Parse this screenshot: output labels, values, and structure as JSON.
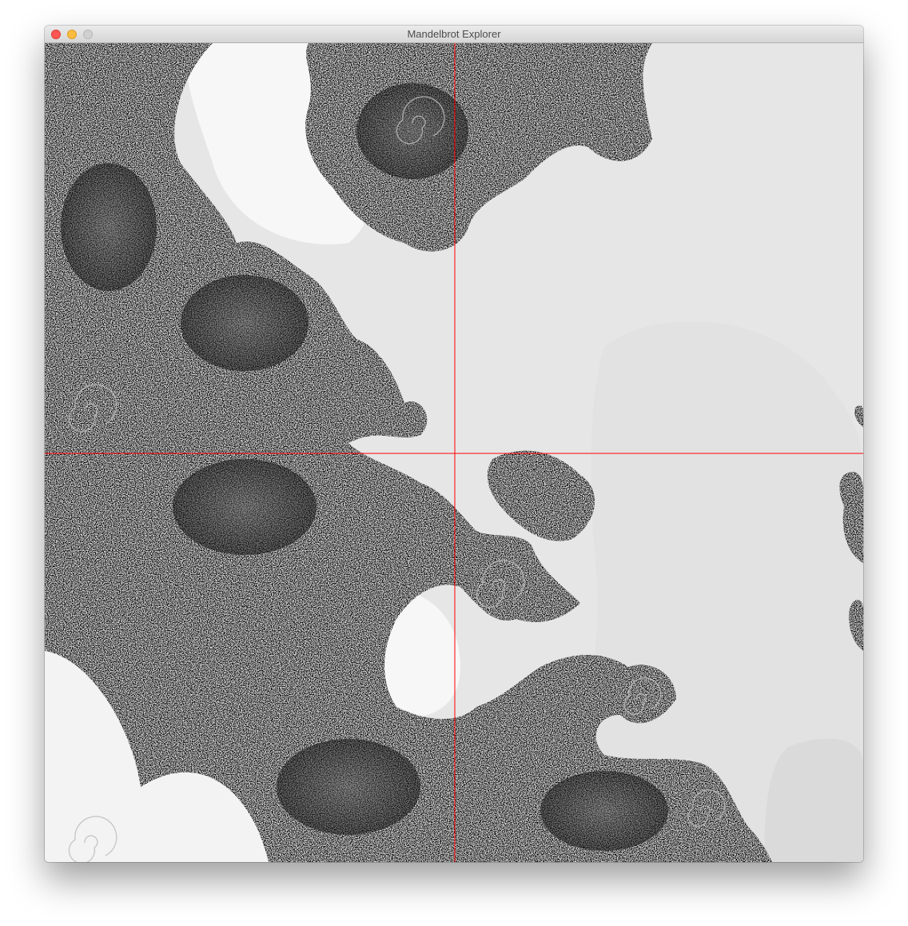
{
  "window": {
    "title": "Mandelbrot Explorer",
    "controls": [
      "close",
      "minimize",
      "zoom"
    ]
  },
  "view": {
    "crosshair_color": "#ff0000",
    "interior_color": "#000000",
    "exterior_colors": [
      "#f7f7f7",
      "#f1f1f1",
      "#e8e8e8",
      "#e2e2e2",
      "#dadada"
    ]
  }
}
